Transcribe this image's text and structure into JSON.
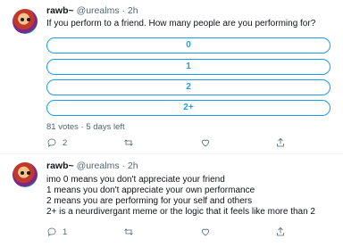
{
  "tweets": [
    {
      "author": {
        "name": "rawb~",
        "handle": "@urealms",
        "separator": "·",
        "time": "2h"
      },
      "text_lines": [
        "If you perform to a friend. How many people are you performing for?"
      ],
      "poll": {
        "options": [
          "0",
          "1",
          "2",
          "2+"
        ],
        "votes": "81 votes",
        "separator": "·",
        "time_left": "5 days left"
      },
      "actions": {
        "reply_count": "2",
        "retweet_count": "",
        "like_count": "",
        "share_count": ""
      },
      "icons": [
        "reply-icon",
        "retweet-icon",
        "like-icon",
        "share-icon"
      ]
    },
    {
      "author": {
        "name": "rawb~",
        "handle": "@urealms",
        "separator": "·",
        "time": "2h"
      },
      "text_lines": [
        "imo 0 means you don't appreciate your friend",
        "1 means you don't appreciate your own performance",
        "2 means you are performing for your self and others",
        "2+ is a neurdivergant meme or the logic that it feels like more than 2"
      ],
      "actions": {
        "reply_count": "1",
        "retweet_count": "",
        "like_count": "",
        "share_count": ""
      },
      "icons": [
        "reply-icon",
        "retweet-icon",
        "like-icon",
        "share-icon"
      ]
    }
  ],
  "colors": {
    "accent": "#1d9bf0",
    "secondary_text": "#536471",
    "primary_text": "#0f1419",
    "divider": "#eff3f4"
  }
}
